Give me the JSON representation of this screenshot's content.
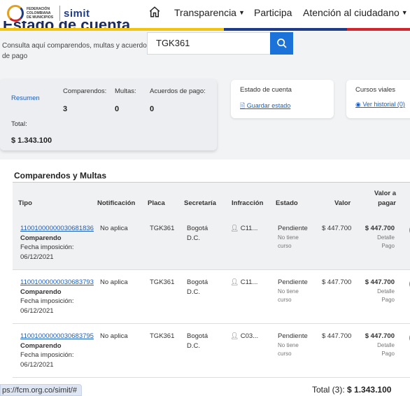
{
  "nav": {
    "logo_text": "FEDERACIÓN COLOMBIANA DE MUNICIPIOS",
    "logo_brand": "simit",
    "items": [
      {
        "label": "Transparencia",
        "caret": true
      },
      {
        "label": "Participa",
        "caret": false
      },
      {
        "label": "Atención al ciudadano",
        "caret": true
      }
    ],
    "colors": {
      "yellow": "#f1c40f",
      "blue": "#1f3c88",
      "red": "#d0262e"
    }
  },
  "header": {
    "title": "Estado de cuenta",
    "subtitle": "Consulta aquí comparendos, multas y acuerdos de pago",
    "search_value": "TGK361"
  },
  "summary": {
    "resumen_label": "Resumen",
    "comparendos_label": "Comparendos:",
    "comparendos_value": "3",
    "multas_label": "Multas:",
    "multas_value": "0",
    "acuerdos_label": "Acuerdos de pago:",
    "acuerdos_value": "0",
    "total_label": "Total:",
    "total_value": "$ 1.343.100"
  },
  "estado_card": {
    "title": "Estado de cuenta",
    "link": "Guardar estado"
  },
  "cursos_card": {
    "title": "Cursos viales",
    "link": "Ver historial (0)"
  },
  "table": {
    "title": "Comparendos y Multas",
    "headers": {
      "tipo": "Tipo",
      "notificacion": "Notificación",
      "placa": "Placa",
      "secretaria": "Secretaría",
      "infraccion": "Infracción",
      "estado": "Estado",
      "valor": "Valor",
      "valor_pagar": "Valor a pagar"
    },
    "rows": [
      {
        "numero": "11001000000030681836",
        "tipo": "Comparendo",
        "fecha_label": "Fecha imposición:",
        "fecha": "06/12/2021",
        "notificacion": "No aplica",
        "placa": "TGK361",
        "secretaria": "Bogotá D.C.",
        "infraccion": "C11...",
        "estado": "Pendiente",
        "estado_sub": "No tiene curso",
        "valor": "$ 447.700",
        "valor_pagar": "$ 447.700",
        "detalle": "Detalle Pago"
      },
      {
        "numero": "11001000000030683793",
        "tipo": "Comparendo",
        "fecha_label": "Fecha imposición:",
        "fecha": "06/12/2021",
        "notificacion": "No aplica",
        "placa": "TGK361",
        "secretaria": "Bogotá D.C.",
        "infraccion": "C11...",
        "estado": "Pendiente",
        "estado_sub": "No tiene curso",
        "valor": "$ 447.700",
        "valor_pagar": "$ 447.700",
        "detalle": "Detalle Pago"
      },
      {
        "numero": "11001000000030683795",
        "tipo": "Comparendo",
        "fecha_label": "Fecha imposición:",
        "fecha": "06/12/2021",
        "notificacion": "No aplica",
        "placa": "TGK361",
        "secretaria": "Bogotá D.C.",
        "infraccion": "C03...",
        "estado": "Pendiente",
        "estado_sub": "No tiene curso",
        "valor": "$ 447.700",
        "valor_pagar": "$ 447.700",
        "detalle": "Detalle Pago"
      }
    ],
    "total_label": "Total (3):",
    "total_value": "$ 1.343.100"
  },
  "status_bar": {
    "url": "ps://fcm.org.co/simit/#"
  }
}
